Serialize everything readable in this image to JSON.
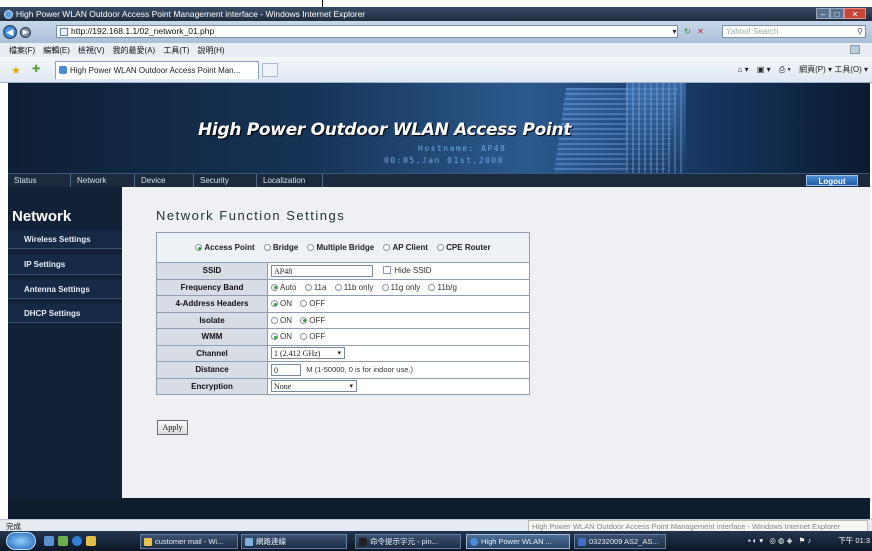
{
  "browser": {
    "window_title": "High Power WLAN Outdoor Access Point Management interface - Windows Internet Explorer",
    "url": "http://192.168.1.1/02_network_01.php",
    "search_placeholder": "Yahoo! Search",
    "menus": [
      "檔案(F)",
      "編輯(E)",
      "檢視(V)",
      "我的最愛(A)",
      "工具(T)",
      "說明(H)"
    ],
    "tab_title": "High Power WLAN Outdoor Access Point Man...",
    "command_bar": "網頁(P) ▾  工具(O) ▾",
    "status_text": "完成",
    "tooltip": "High Power WLAN Outdoor Access Point Management interface - Windows Internet Explorer"
  },
  "banner": {
    "title": "High Power Outdoor WLAN Access Point",
    "hostname": "Hostname: AP48",
    "datetime": "00:05,Jan 01st,2000"
  },
  "topnav": {
    "items": [
      "Status",
      "Network",
      "Device",
      "Security",
      "Localization"
    ],
    "logout": "Logout"
  },
  "sidebar": {
    "heading": "Network",
    "items": [
      "Wireless Settings",
      "IP Settings",
      "Antenna Settings",
      "DHCP Settings"
    ]
  },
  "main": {
    "title": "Network Function Settings",
    "modes": [
      "Access Point",
      "Bridge",
      "Multiple Bridge",
      "AP Client",
      "CPE Router"
    ],
    "selected_mode": "Access Point",
    "ssid": {
      "label": "SSID",
      "value": "AP48",
      "hide_label": "Hide SSID"
    },
    "frequency_band": {
      "label": "Frequency Band",
      "options": [
        "Auto",
        "11a",
        "11b only",
        "11g only",
        "11b/g"
      ],
      "selected": "Auto"
    },
    "four_address": {
      "label": "4-Address Headers",
      "options": [
        "ON",
        "OFF"
      ],
      "selected": "ON"
    },
    "isolate": {
      "label": "Isolate",
      "options": [
        "ON",
        "OFF"
      ],
      "selected": "OFF"
    },
    "wmm": {
      "label": "WMM",
      "options": [
        "ON",
        "OFF"
      ],
      "selected": "ON"
    },
    "channel": {
      "label": "Channel",
      "value": "1 (2.412 GHz)"
    },
    "distance": {
      "label": "Distance",
      "value": "0",
      "note": "M (1-50000, 0 is for indoor use.)"
    },
    "encryption": {
      "label": "Encryption",
      "value": "None"
    },
    "apply_label": "Apply"
  },
  "taskbar": {
    "tasks": [
      "customer mail - Wi...",
      "網路連線",
      "命令提示字元 - pin...",
      "High Power WLAN ...",
      "03232009 AS2_AS..."
    ],
    "clock": "下午 01:3"
  }
}
